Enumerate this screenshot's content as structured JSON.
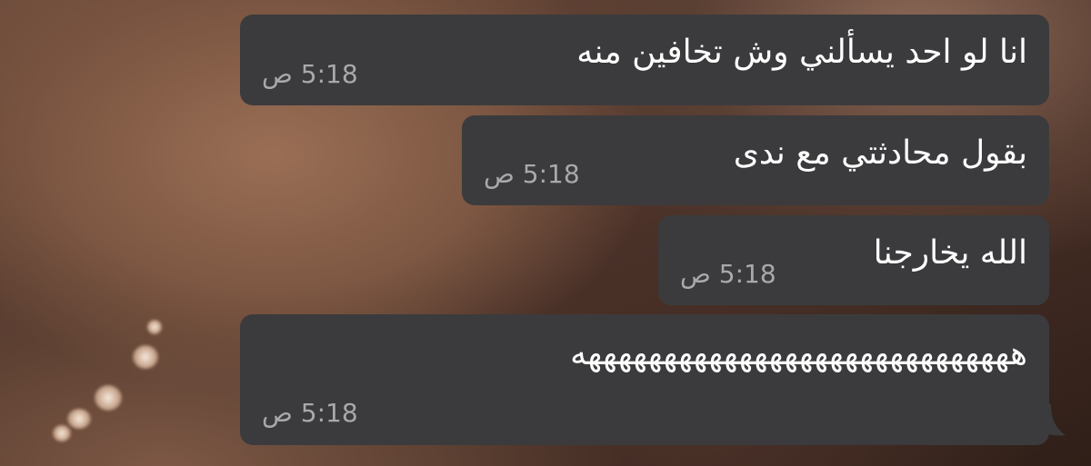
{
  "chat": {
    "messages": [
      {
        "text": "انا لو احد يسألني وش تخافين منه",
        "time": "5:18 ص"
      },
      {
        "text": "بقول محادثتي مع ندى",
        "time": "5:18 ص"
      },
      {
        "text": "الله يخارجنا",
        "time": "5:18 ص"
      },
      {
        "text": "هههههههههههههههههههههههههههههه",
        "time": "5:18 ص"
      }
    ]
  },
  "colors": {
    "bubble": "#3b3b3d",
    "message_text": "#ffffff",
    "timestamp": "#a9a9ab"
  }
}
